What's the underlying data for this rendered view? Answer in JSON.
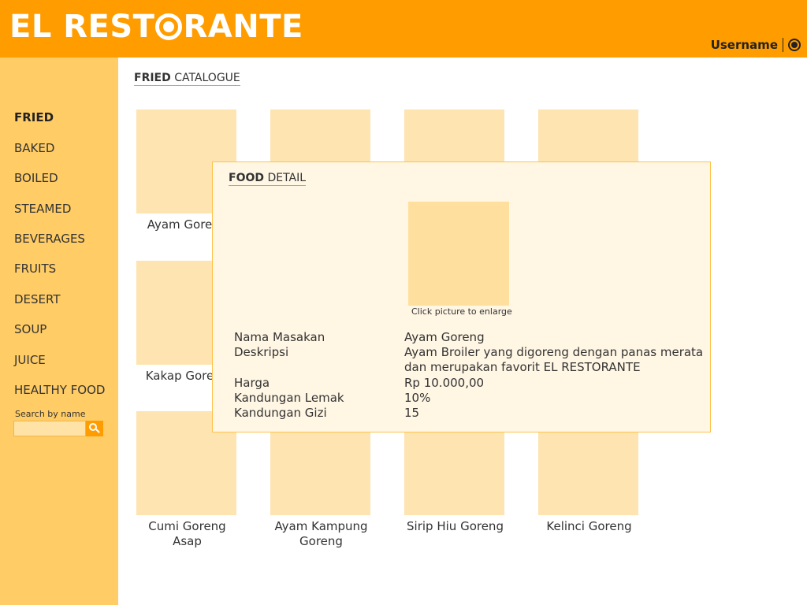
{
  "header": {
    "logo_part1": "EL REST",
    "logo_part2": "RANTE",
    "username": "Username"
  },
  "sidebar": {
    "items": [
      {
        "label": "FRIED"
      },
      {
        "label": "BAKED"
      },
      {
        "label": "BOILED"
      },
      {
        "label": "STEAMED"
      },
      {
        "label": "BEVERAGES"
      },
      {
        "label": "FRUITS"
      },
      {
        "label": "DESERT"
      },
      {
        "label": "SOUP"
      },
      {
        "label": "JUICE"
      },
      {
        "label": "HEALTHY FOOD"
      }
    ],
    "active": "FRIED",
    "search_label": "Search by name",
    "search_value": ""
  },
  "catalogue": {
    "title_bold": "FRIED",
    "title_rest": " CATALOGUE",
    "items": [
      {
        "name": "Ayam Goreng"
      },
      {
        "name": ""
      },
      {
        "name": ""
      },
      {
        "name": ""
      },
      {
        "name": "Kakap Goreng"
      },
      {
        "name": ""
      },
      {
        "name": ""
      },
      {
        "name": ""
      },
      {
        "name": "Cumi Goreng Asap"
      },
      {
        "name": "Ayam Kampung Goreng"
      },
      {
        "name": "Sirip Hiu Goreng"
      },
      {
        "name": "Kelinci Goreng"
      }
    ]
  },
  "modal": {
    "title_bold": "FOOD",
    "title_rest": " DETAIL",
    "hint": "Click picture to enlarge",
    "fields": [
      {
        "label": "Nama Masakan",
        "value": "Ayam Goreng"
      },
      {
        "label": "Deskripsi",
        "value": "Ayam Broiler yang digoreng dengan panas merata dan merupakan favorit EL RESTORANTE"
      },
      {
        "label": "Harga",
        "value": "Rp 10.000,00"
      },
      {
        "label": "Kandungan Lemak",
        "value": "10%"
      },
      {
        "label": "Kandungan Gizi",
        "value": "15"
      }
    ]
  },
  "colors": {
    "header": "#ff9d00",
    "sidebar": "#ffcc66",
    "thumbnail": "#fde4b0",
    "modal_bg": "#fff6e4"
  }
}
